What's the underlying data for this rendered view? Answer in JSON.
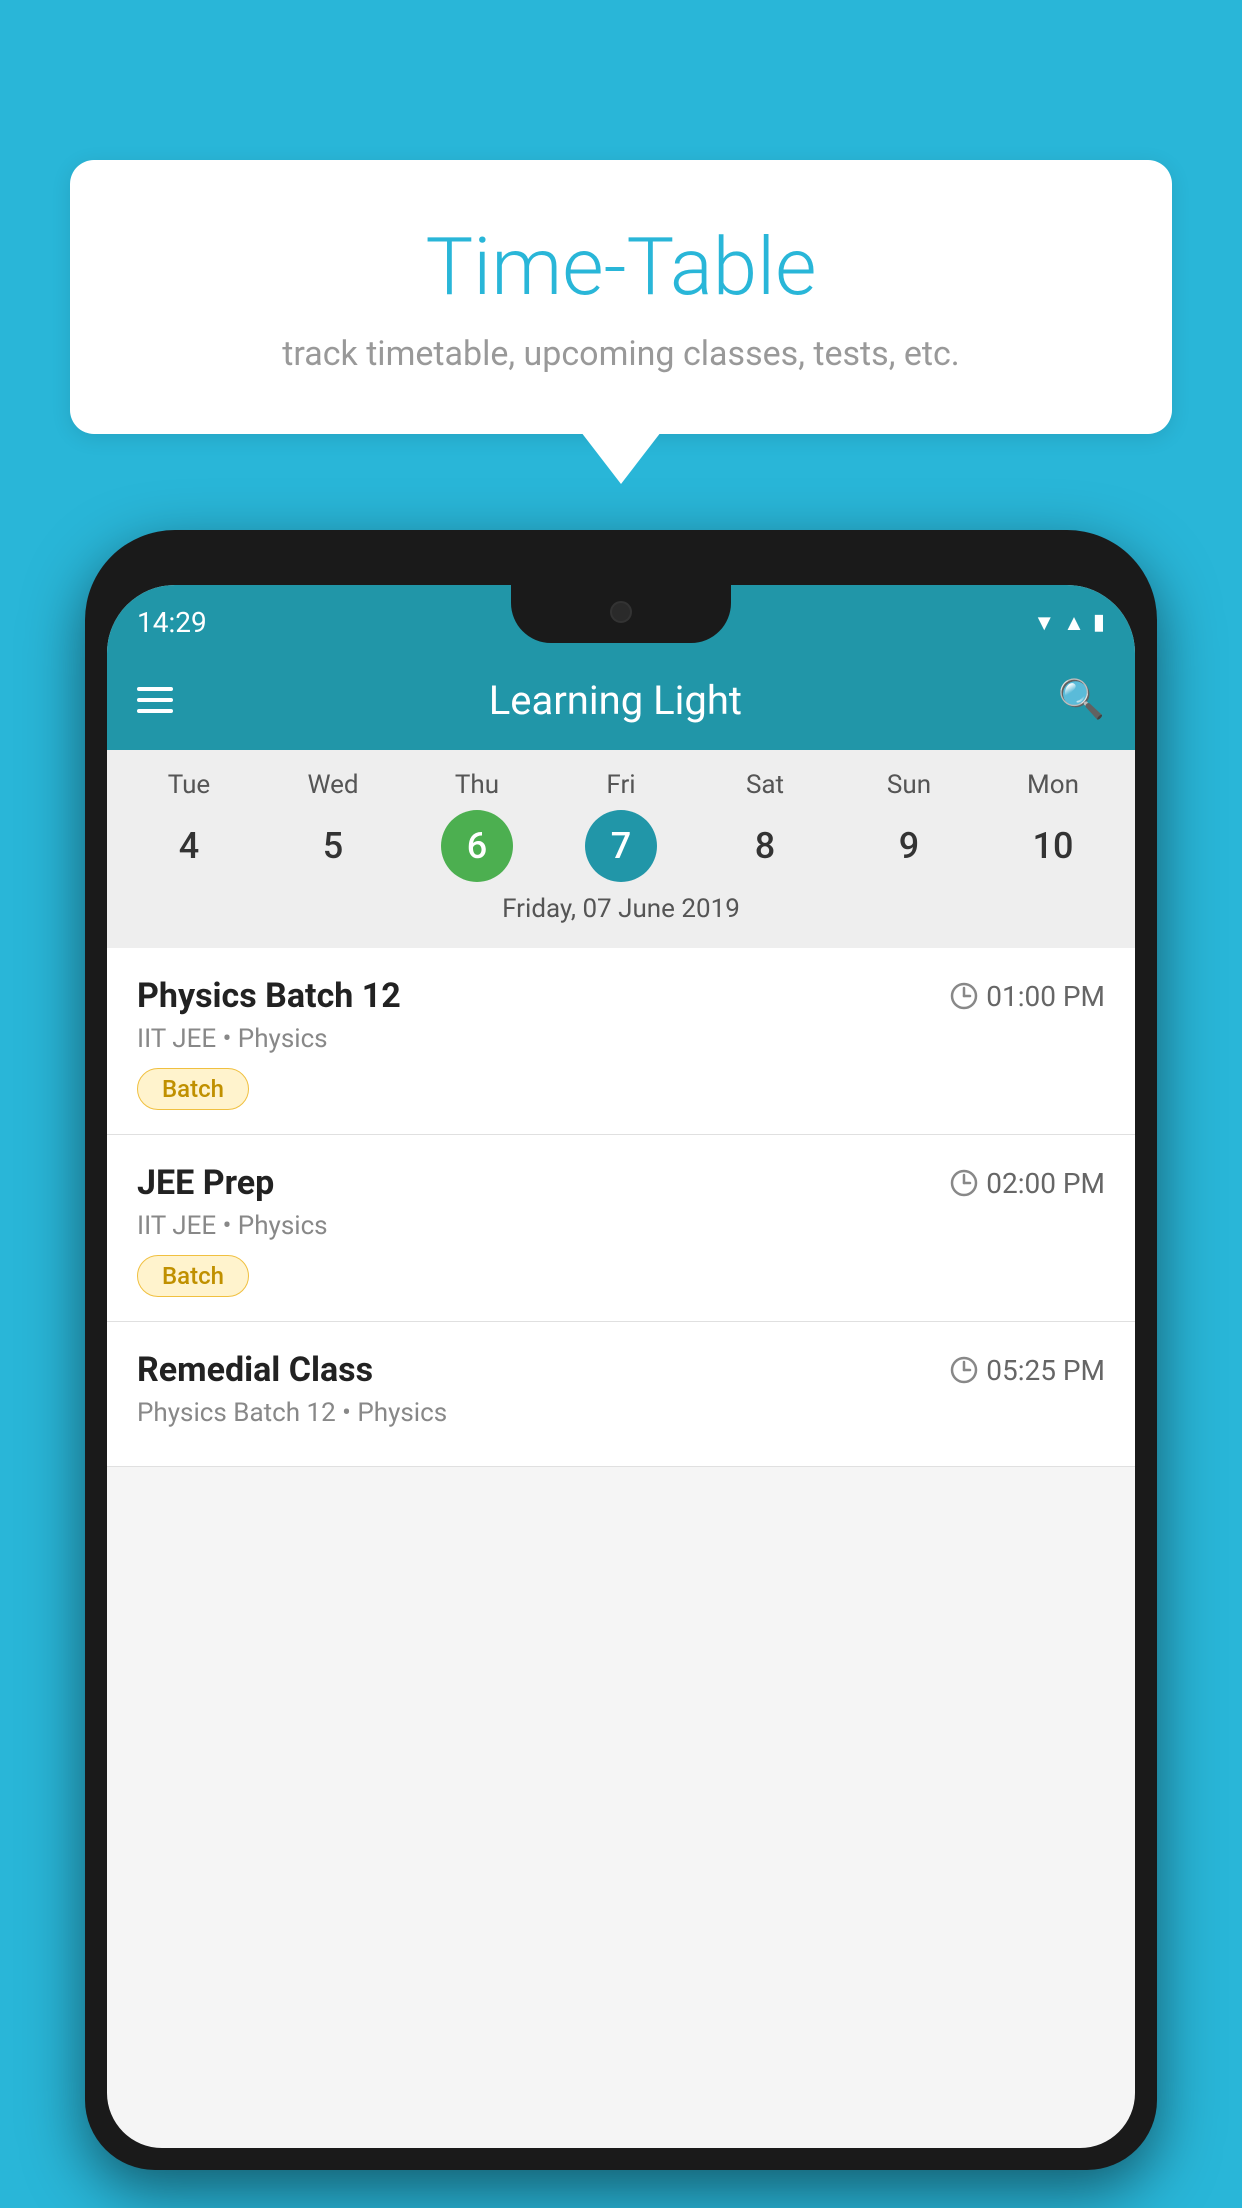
{
  "header": {
    "title": "Time-Table",
    "subtitle": "track timetable, upcoming classes, tests, etc."
  },
  "app": {
    "name": "Learning Light",
    "status_time": "14:29"
  },
  "calendar": {
    "current_date_label": "Friday, 07 June 2019",
    "days": [
      {
        "label": "Tue",
        "num": "4",
        "state": "normal"
      },
      {
        "label": "Wed",
        "num": "5",
        "state": "normal"
      },
      {
        "label": "Thu",
        "num": "6",
        "state": "today"
      },
      {
        "label": "Fri",
        "num": "7",
        "state": "selected"
      },
      {
        "label": "Sat",
        "num": "8",
        "state": "normal"
      },
      {
        "label": "Sun",
        "num": "9",
        "state": "normal"
      },
      {
        "label": "Mon",
        "num": "10",
        "state": "normal"
      }
    ]
  },
  "schedule": [
    {
      "name": "Physics Batch 12",
      "time": "01:00 PM",
      "sub": "IIT JEE • Physics",
      "badge": "Batch"
    },
    {
      "name": "JEE Prep",
      "time": "02:00 PM",
      "sub": "IIT JEE • Physics",
      "badge": "Batch"
    },
    {
      "name": "Remedial Class",
      "time": "05:25 PM",
      "sub": "Physics Batch 12 • Physics",
      "badge": ""
    }
  ],
  "labels": {
    "hamburger": "☰",
    "search": "🔍",
    "batch": "Batch"
  }
}
